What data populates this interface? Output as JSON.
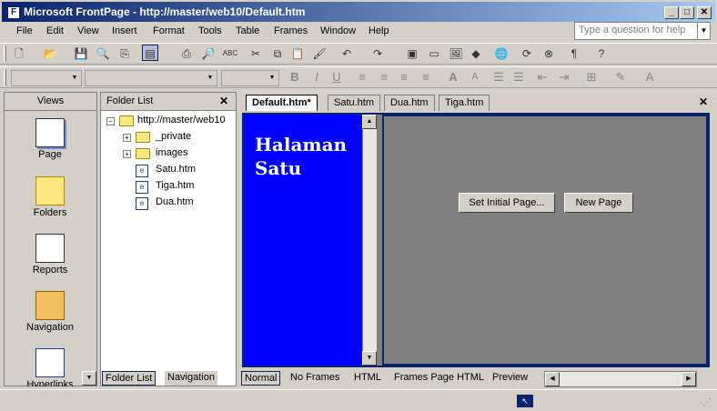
{
  "window": {
    "title": "Microsoft FrontPage - http://master/web10/Default.htm",
    "minimize": "_",
    "maximize": "□",
    "close": "✕"
  },
  "menu": [
    "File",
    "Edit",
    "View",
    "Insert",
    "Format",
    "Tools",
    "Table",
    "Frames",
    "Window",
    "Help"
  ],
  "help_placeholder": "Type a question for help",
  "views": {
    "header": "Views",
    "items": [
      "Page",
      "Folders",
      "Reports",
      "Navigation",
      "Hyperlinks"
    ]
  },
  "folder_list": {
    "header": "Folder List",
    "root": "http://master/web10",
    "items": [
      "_private",
      "images",
      "Satu.htm",
      "Tiga.htm",
      "Dua.htm"
    ],
    "bottom_tabs": [
      "Folder List",
      "Navigation"
    ]
  },
  "doc_tabs": [
    "Default.htm*",
    "Satu.htm",
    "Dua.htm",
    "Tiga.htm"
  ],
  "left_frame_text": [
    "Halaman",
    "Satu"
  ],
  "frame_buttons": [
    "Set Initial Page...",
    "New Page"
  ],
  "view_tabs": [
    "Normal",
    "No Frames",
    "HTML",
    "Frames Page HTML",
    "Preview"
  ],
  "colors": {
    "title_start": "#0a246a",
    "frame_blue": "#0000ff",
    "chrome": "#d4d0c8"
  }
}
